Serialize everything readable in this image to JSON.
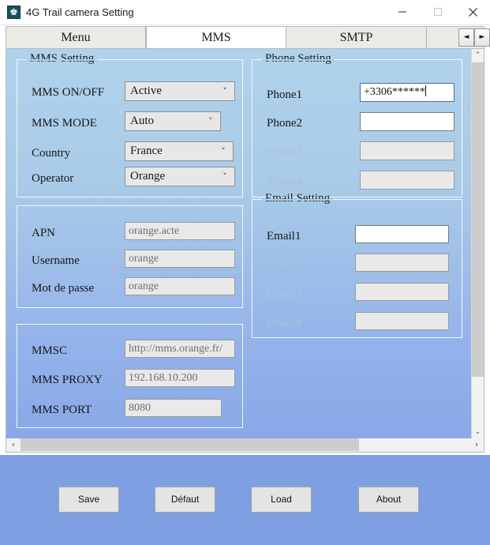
{
  "window": {
    "title": "4G Trail camera Setting",
    "icon": "app-camera-icon",
    "minimize": "—",
    "maximize": "□",
    "close": "✕"
  },
  "tabs": [
    {
      "label": "Menu",
      "active": false
    },
    {
      "label": "MMS",
      "active": true
    },
    {
      "label": "SMTP",
      "active": false
    }
  ],
  "tab_scroll": {
    "left": "◄",
    "right": "►"
  },
  "mms_setting": {
    "title": "MMS Setting",
    "rows": [
      {
        "label": "MMS ON/OFF",
        "value": "Active"
      },
      {
        "label": "MMS MODE",
        "value": "Auto"
      },
      {
        "label": "Country",
        "value": "France"
      },
      {
        "label": "Operator",
        "value": "Orange"
      }
    ]
  },
  "apn_setting": {
    "rows": [
      {
        "label": "APN",
        "value": "orange.acte"
      },
      {
        "label": "Username",
        "value": "orange"
      },
      {
        "label": "Mot de passe",
        "value": "orange"
      }
    ]
  },
  "mmsc_setting": {
    "rows": [
      {
        "label": "MMSC",
        "value": "http://mms.orange.fr/"
      },
      {
        "label": "MMS PROXY",
        "value": "192.168.10.200"
      },
      {
        "label": "MMS PORT",
        "value": "8080"
      }
    ]
  },
  "phone_setting": {
    "title": "Phone Setting",
    "rows": [
      {
        "label": "Phone1",
        "value": "+3306******",
        "enabled": true,
        "focused": true
      },
      {
        "label": "Phone2",
        "value": "",
        "enabled": true,
        "focused": false
      },
      {
        "label": "Phone3",
        "value": "",
        "enabled": false,
        "focused": false
      },
      {
        "label": "Phone4",
        "value": "",
        "enabled": false,
        "focused": false
      }
    ]
  },
  "email_setting": {
    "title": "Email Setting",
    "rows": [
      {
        "label": "Email1",
        "value": "",
        "enabled": true
      },
      {
        "label": "Email2",
        "value": "",
        "enabled": false
      },
      {
        "label": "Email3",
        "value": "",
        "enabled": false
      },
      {
        "label": "Email4",
        "value": "",
        "enabled": false
      }
    ]
  },
  "buttons": {
    "save": "Save",
    "defaut": "Défaut",
    "load": "Load",
    "about": "About"
  },
  "scrollbars": {
    "v_up": "⌃",
    "v_down": "⌄",
    "h_left": "‹",
    "h_right": "›"
  },
  "colors": {
    "content_top": "#b1d2ea",
    "content_bottom": "#88a8e8",
    "bottom_panel": "#7f9fe3",
    "focus_border": "#3f6fb0",
    "disabled_label": "#a8c2e0"
  }
}
